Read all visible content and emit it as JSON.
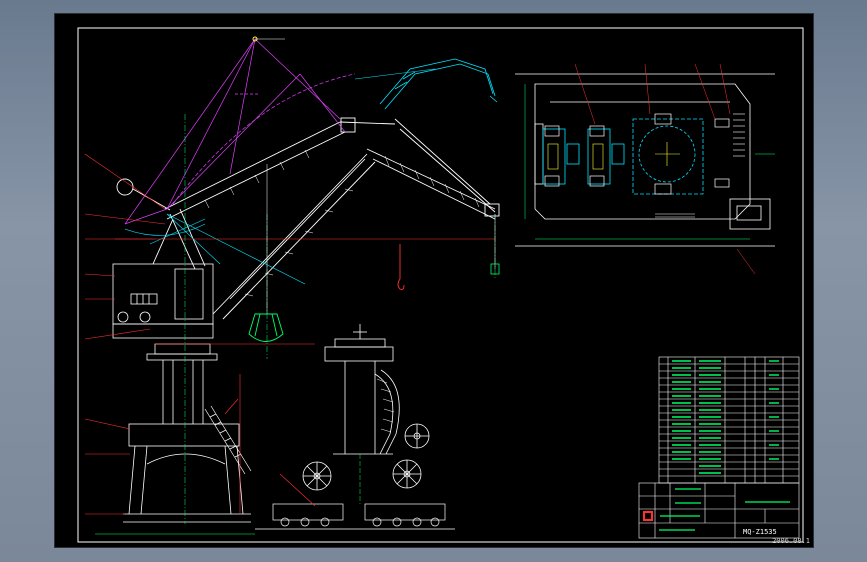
{
  "drawing": {
    "drawing_number": "MQ-Z1535",
    "date_text": "2006.08.1",
    "colors": {
      "sheet": "#000000",
      "frame": "#ffffff",
      "structure": "#ffffff",
      "cyan": "#00e5ff",
      "magenta": "#e040fb",
      "green": "#00ff66",
      "red": "#ff3030",
      "yellow": "#ffff33",
      "blue": "#4040ff"
    },
    "parts_table_rows": 18,
    "title_block_rows": 4
  }
}
